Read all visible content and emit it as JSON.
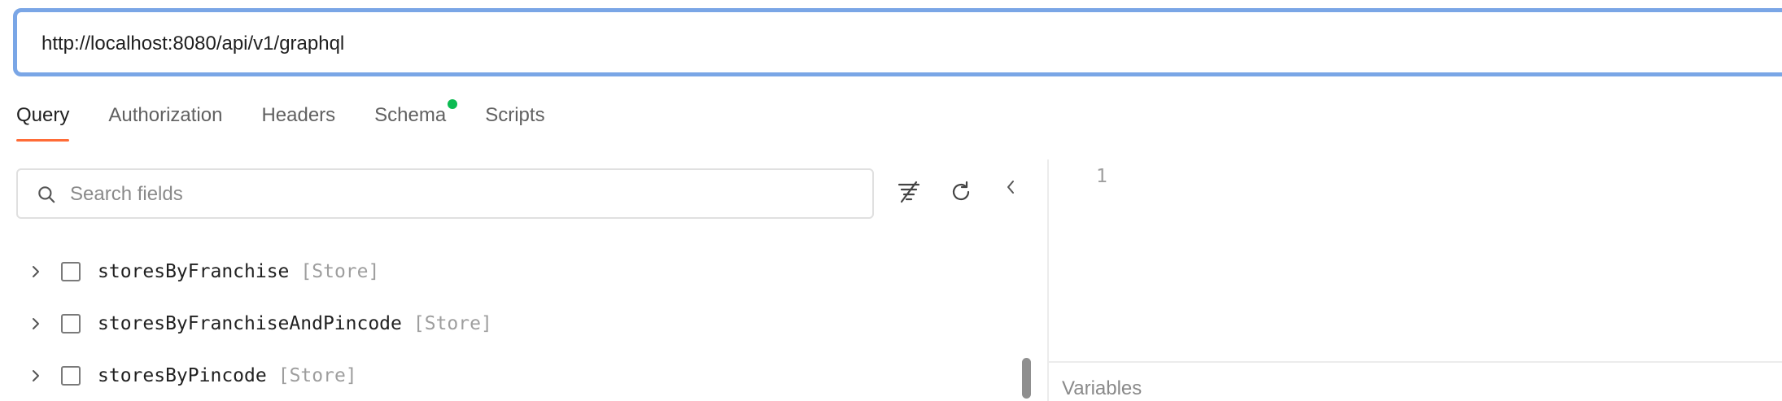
{
  "url": {
    "value": "http://localhost:8080/api/v1/graphql"
  },
  "tabs": [
    {
      "label": "Query",
      "active": true
    },
    {
      "label": "Authorization",
      "active": false
    },
    {
      "label": "Headers",
      "active": false
    },
    {
      "label": "Schema",
      "active": false,
      "status_dot": true
    },
    {
      "label": "Scripts",
      "active": false
    }
  ],
  "search": {
    "placeholder": "Search fields",
    "icon": "search-icon"
  },
  "toolbar": {
    "icons": [
      "clear-filter-icon",
      "refresh-icon",
      "collapse-left-icon"
    ]
  },
  "fields": [
    {
      "name": "storesByFranchise",
      "type": "[Store]"
    },
    {
      "name": "storesByFranchiseAndPincode",
      "type": "[Store]"
    },
    {
      "name": "storesByPincode",
      "type": "[Store]"
    }
  ],
  "editor": {
    "line_number": "1"
  },
  "variables": {
    "label": "Variables"
  },
  "colors": {
    "url_border": "#7aa6e6",
    "active_tab_underline": "#ff6c37",
    "schema_status_dot": "#0cbb52"
  }
}
